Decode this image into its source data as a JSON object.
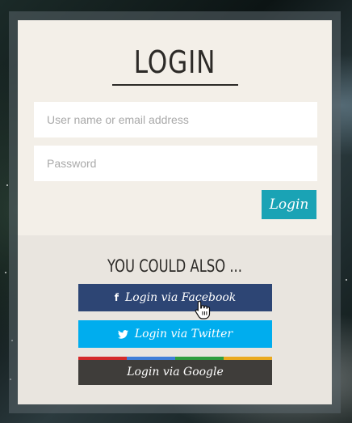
{
  "login_form": {
    "title": "LOGIN",
    "username_placeholder": "User name or email address",
    "password_placeholder": "Password",
    "submit_label": "Login"
  },
  "social": {
    "heading": "YOU COULD ALSO ...",
    "facebook": {
      "label": "Login via Facebook",
      "icon": "facebook-icon",
      "color": "#2d4574"
    },
    "twitter": {
      "label": "Login via Twitter",
      "icon": "twitter-icon",
      "color": "#00adee"
    },
    "google": {
      "label": "Login via Google",
      "color": "#3f3d3a",
      "stripe_colors": [
        "#d42a2a",
        "#3f7ed8",
        "#2f9d3f",
        "#eaa91e"
      ]
    }
  },
  "colors": {
    "accent": "#1aa3b5",
    "panel": "#f3efe8",
    "text": "#2c2a27"
  }
}
